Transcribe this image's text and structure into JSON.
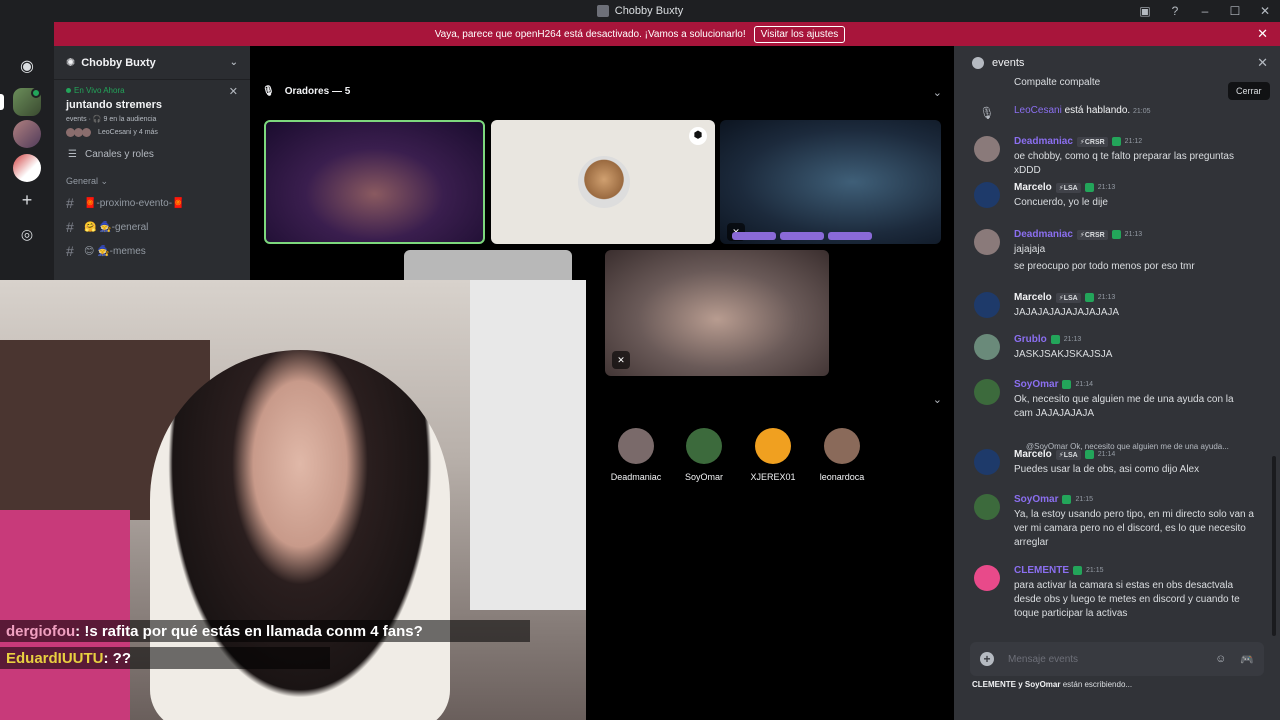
{
  "window": {
    "title": "Chobby Buxty"
  },
  "banner": {
    "text": "Vaya, parece que openH264 está desactivado. ¡Vamos a solucionarlo!",
    "button": "Visitar los ajustes"
  },
  "sidebar": {
    "server_name": "Chobby Buxty",
    "live_now": "En Vivo Ahora",
    "event_title": "juntando stremers",
    "event_meta": "events · 🎧 9 en la audiencia",
    "event_people": "LeoCesani y 4 más",
    "channels_roles": "Canales y roles",
    "category": "General",
    "channels": [
      "🧧-proximo-evento-🧧",
      "🤗 🧙-general",
      "😊 🧙-memes"
    ]
  },
  "stage": {
    "speakers_header": "Oradores — 5",
    "audience": [
      {
        "name": "Deadmaniac",
        "color": "#7a6a6a"
      },
      {
        "name": "SoyOmar",
        "color": "#3c6a3c"
      },
      {
        "name": "XJEREX01",
        "color": "#f0a020"
      },
      {
        "name": "leonardoca",
        "color": "#8a6a5a"
      }
    ]
  },
  "overlay_chat": [
    {
      "user": "dergiofou",
      "text": " : !s rafita por qué estás en llamada conm 4 fans?"
    },
    {
      "user": "EduardIUUTU",
      "text": " : ??"
    }
  ],
  "chat": {
    "channel": "events",
    "tooltip": "Cerrar",
    "top_cut": "Compalte compalte",
    "speaking": {
      "user": "LeoCesani",
      "text": "está hablando.",
      "time": "21:05"
    },
    "messages": [
      {
        "name": "Deadmaniac",
        "tag": "⚡CRSR",
        "time": "21:12",
        "text": "oe chobby, como q te falto preparar las preguntas xDDD",
        "color": "purple",
        "av": "#8a7a7a"
      },
      {
        "name": "Marcelo",
        "tag": "⚡LSA",
        "time": "21:13",
        "text": "Concuerdo, yo le dije",
        "color": "white",
        "av": "#1e3a6a"
      },
      {
        "name": "Deadmaniac",
        "tag": "⚡CRSR",
        "time": "21:13",
        "text": "jajajaja",
        "color": "purple",
        "av": "#8a7a7a"
      },
      {
        "name": "",
        "tag": "",
        "time": "",
        "text": "se preocupo por todo menos por eso tmr",
        "color": "white",
        "av": ""
      },
      {
        "name": "Marcelo",
        "tag": "⚡LSA",
        "time": "21:13",
        "text": "JAJAJAJAJAJAJAJAJA",
        "color": "white",
        "av": "#1e3a6a"
      },
      {
        "name": "Grublo",
        "tag": "",
        "time": "21:13",
        "text": "JASKJSAKJSKAJSJA",
        "color": "purple",
        "av": "#6a8a7a"
      },
      {
        "name": "SoyOmar",
        "tag": "",
        "time": "21:14",
        "text": "Ok, necesito que alguien me de una ayuda con la cam JAJAJAJAJA",
        "color": "purple",
        "av": "#3c6a3c"
      },
      {
        "name": "Marcelo",
        "tag": "⚡LSA",
        "time": "21:14",
        "text": "Puedes usar la de obs, asi como dijo Alex",
        "color": "white",
        "av": "#1e3a6a"
      },
      {
        "name": "SoyOmar",
        "tag": "",
        "time": "21:15",
        "text": "Ya, la estoy usando pero tipo, en mi directo solo van a ver mi camara pero no el discord, es lo que necesito arreglar",
        "color": "purple",
        "av": "#3c6a3c"
      },
      {
        "name": "CLEMENTE",
        "tag": "",
        "time": "21:15",
        "text": "para activar la camara si estas en obs desactvala desde obs y luego te metes en discord y cuando te toque participar la activas",
        "color": "purple",
        "av": "#e84a8a"
      }
    ],
    "reply_preview": "@SoyOmar Ok, necesito que alguien me de una ayuda...",
    "composer_placeholder": "Mensaje events",
    "typing_users": "CLEMENTE y SoyOmar",
    "typing_suffix": " están escribiendo..."
  }
}
